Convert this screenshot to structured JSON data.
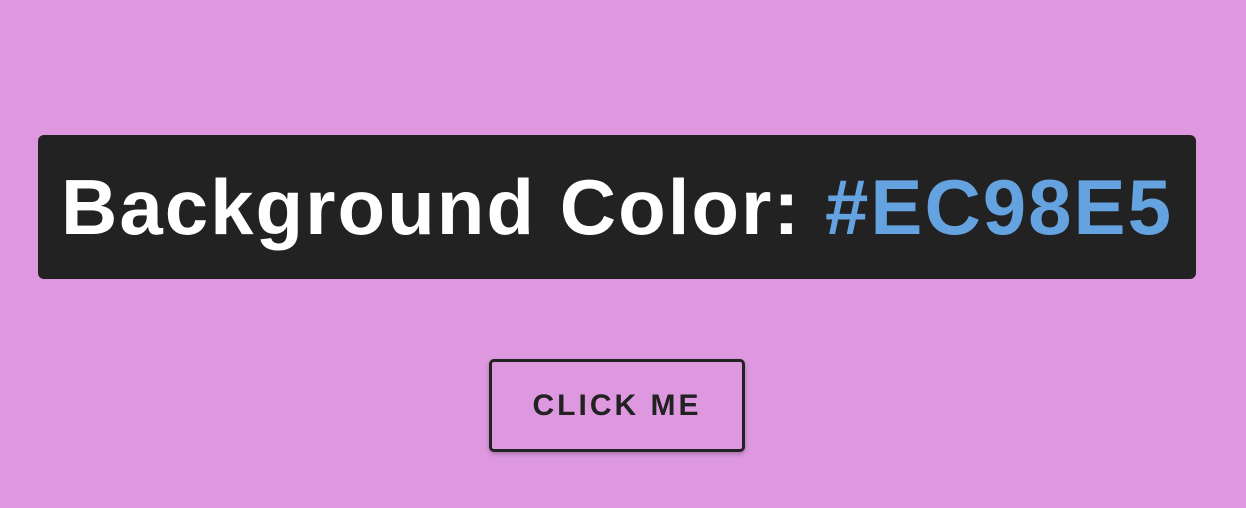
{
  "colors": {
    "page_background": "#DD98E0",
    "banner_background": "#222222",
    "banner_text": "#FFFFFF",
    "hex_accent": "#64A2E0",
    "button_border": "#222222"
  },
  "banner": {
    "label": "Background Color: ",
    "hex_value": "#EC98E5"
  },
  "button": {
    "label": "CLICK ME"
  }
}
